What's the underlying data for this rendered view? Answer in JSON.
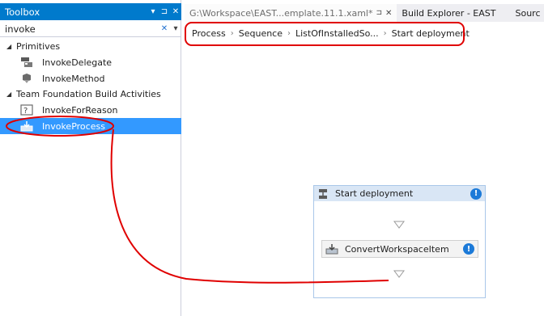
{
  "toolbox": {
    "title": "Toolbox",
    "header_buttons": [
      "▾",
      "⊐",
      "✕"
    ],
    "search_value": "invoke",
    "categories": [
      {
        "label": "Primitives",
        "items": [
          {
            "label": "InvokeDelegate",
            "icon": "delegate-icon"
          },
          {
            "label": "InvokeMethod",
            "icon": "method-icon"
          }
        ]
      },
      {
        "label": "Team Foundation Build Activities",
        "items": [
          {
            "label": "InvokeForReason",
            "icon": "reason-icon"
          },
          {
            "label": "InvokeProcess",
            "icon": "process-icon",
            "selected": true
          }
        ]
      }
    ]
  },
  "tabs": [
    {
      "label": "G:\\Workspace\\EAST...emplate.11.1.xaml*",
      "active": true
    },
    {
      "label": "Build Explorer - EAST"
    },
    {
      "label": "Sourc"
    }
  ],
  "breadcrumb": [
    "Process",
    "Sequence",
    "ListOfInstalledSo...",
    "Start deployment"
  ],
  "activity": {
    "title": "Start deployment",
    "child_title": "ConvertWorkspaceItem"
  },
  "colors": {
    "accent": "#007acc",
    "selection": "#3399ff",
    "annotation": "#e00000",
    "activity_header": "#d9e6f5",
    "warning": "#1c7ad8"
  }
}
